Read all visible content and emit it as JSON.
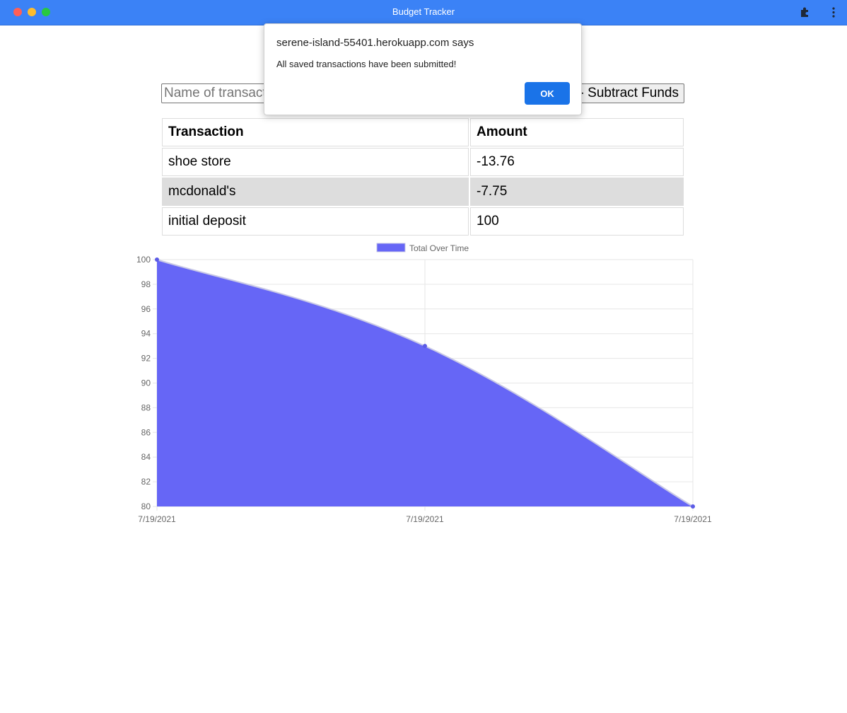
{
  "window": {
    "title": "Budget Tracker"
  },
  "form": {
    "name_placeholder": "Name of transaction",
    "subtract_label": "- Subtract Funds"
  },
  "table": {
    "headers": [
      "Transaction",
      "Amount"
    ],
    "rows": [
      {
        "name": "shoe store",
        "amount": "-13.76"
      },
      {
        "name": "mcdonald's",
        "amount": "-7.75"
      },
      {
        "name": "initial deposit",
        "amount": "100"
      }
    ]
  },
  "dialog": {
    "title": "serene-island-55401.herokuapp.com says",
    "message": "All saved transactions have been submitted!",
    "ok_label": "OK"
  },
  "chart_data": {
    "type": "area",
    "x": [
      "7/19/2021",
      "7/19/2021",
      "7/19/2021"
    ],
    "series": [
      {
        "name": "Total Over Time",
        "values": [
          100,
          93,
          80
        ]
      }
    ],
    "ylim": [
      80,
      100
    ],
    "yticks": [
      100,
      98,
      96,
      94,
      92,
      90,
      88,
      86,
      84,
      82,
      80
    ],
    "legend": "top",
    "grid": true,
    "colors": {
      "fill": "#6666f6",
      "line": "#c8c8e6",
      "point": "#5b5be6"
    }
  }
}
